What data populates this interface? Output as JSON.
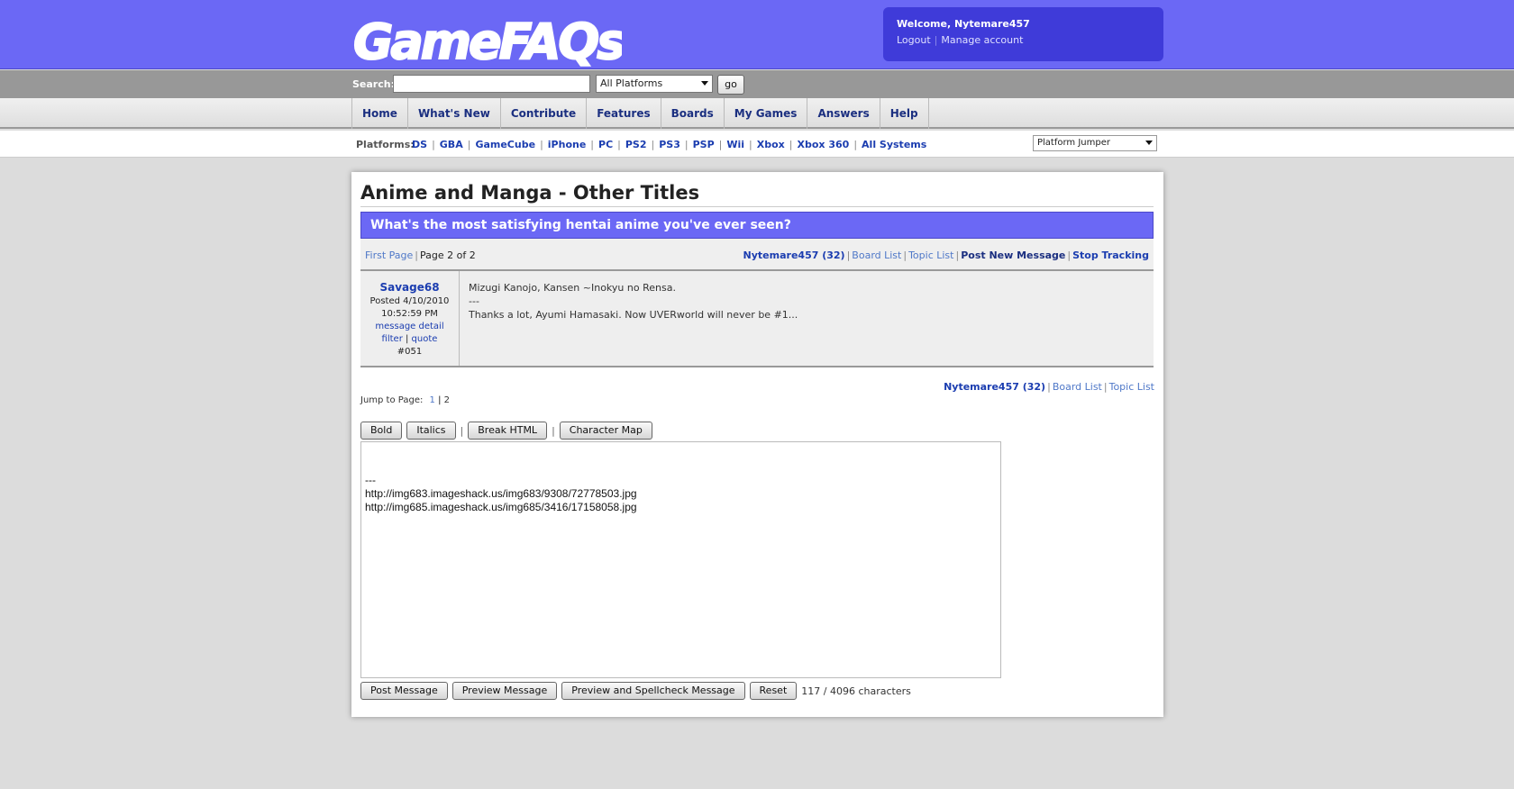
{
  "header": {
    "logo_text": "GameFAQs",
    "welcome": "Welcome, Nytemare457",
    "logout": "Logout",
    "manage_account": "Manage account"
  },
  "search": {
    "label": "Search:",
    "value": "",
    "platform_selected": "All Platforms",
    "go_label": "go"
  },
  "nav": {
    "tabs": [
      "Home",
      "What's New",
      "Contribute",
      "Features",
      "Boards",
      "My Games",
      "Answers",
      "Help"
    ]
  },
  "platforms": {
    "label": "Platforms:",
    "links": [
      "DS",
      "GBA",
      "GameCube",
      "iPhone",
      "PC",
      "PS2",
      "PS3",
      "PSP",
      "Wii",
      "Xbox",
      "Xbox 360",
      "All Systems"
    ],
    "jumper": "Platform Jumper"
  },
  "board": {
    "title": "Anime and Manga - Other Titles",
    "topic": "What's the most satisfying hentai anime you've ever seen?",
    "first_page": "First Page",
    "page_info": "Page 2 of 2",
    "user_link": "Nytemare457 (32)",
    "board_list": "Board List",
    "topic_list": "Topic List",
    "post_new": "Post New Message",
    "stop_tracking": "Stop Tracking"
  },
  "message": {
    "author": "Savage68",
    "posted": "Posted 4/10/2010",
    "time": "10:52:59 PM",
    "detail": "message detail",
    "filter": "filter",
    "quote": "quote",
    "number": "#051",
    "line1": "Mizugi Kanojo, Kansen ~Inokyu no Rensa.",
    "line2": "---",
    "line3": "Thanks a lot, Ayumi Hamasaki. Now UVERworld will never be #1..."
  },
  "jump": {
    "label": "Jump to Page:",
    "page1": "1",
    "page2": "2"
  },
  "editor": {
    "bold": "Bold",
    "italics": "Italics",
    "break_html": "Break HTML",
    "char_map": "Character Map",
    "text": "---\nhttp://img683.imageshack.us/img683/9308/72778503.jpg\nhttp://img685.imageshack.us/img685/3416/17158058.jpg",
    "post": "Post Message",
    "preview": "Preview Message",
    "preview_spell": "Preview and Spellcheck Message",
    "reset": "Reset",
    "char_count": "117 / 4096 characters"
  }
}
